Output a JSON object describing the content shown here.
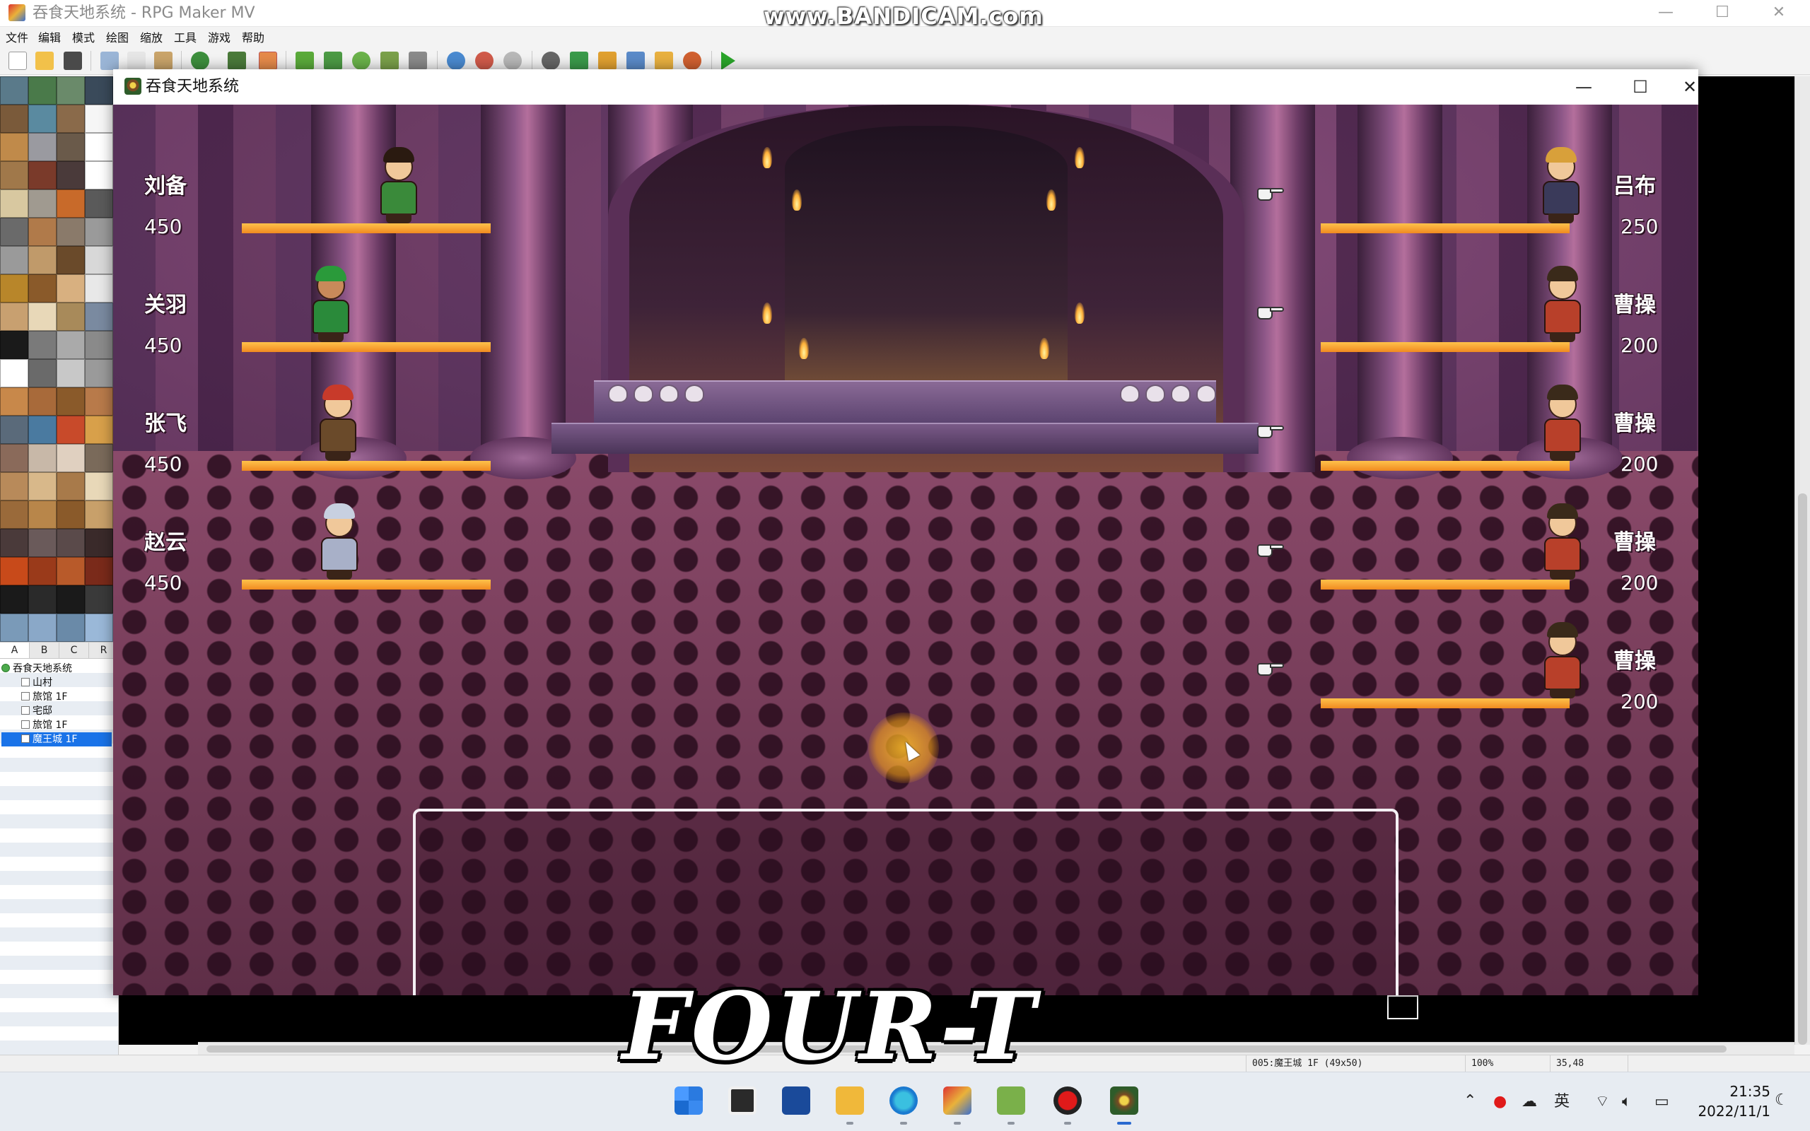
{
  "editor": {
    "title": "吞食天地系统 - RPG Maker MV",
    "watermark": "www.BANDICAM.com",
    "menus": [
      "文件",
      "编辑",
      "模式",
      "绘图",
      "缩放",
      "工具",
      "游戏",
      "帮助"
    ],
    "tileset_tabs": [
      "A",
      "B",
      "C",
      "R"
    ],
    "map_tree": [
      {
        "label": "吞食天地系统",
        "level": 0,
        "selected": false
      },
      {
        "label": "山村",
        "level": 1,
        "selected": false
      },
      {
        "label": "旅馆 1F",
        "level": 1,
        "selected": false
      },
      {
        "label": "宅邸",
        "level": 1,
        "selected": false
      },
      {
        "label": "旅馆 1F",
        "level": 1,
        "selected": false
      },
      {
        "label": "魔王城 1F",
        "level": 1,
        "selected": true
      }
    ],
    "status": {
      "map_info": "005:魔王城 1F (49x50)",
      "zoom": "100%",
      "coords": "35,48"
    }
  },
  "game_window": {
    "title": "吞食天地系统",
    "minimize": "—",
    "maximize": "☐",
    "close": "✕"
  },
  "allies": [
    {
      "name": "刘备",
      "hp": "450",
      "hp_fraction": 1.0
    },
    {
      "name": "关羽",
      "hp": "450",
      "hp_fraction": 1.0
    },
    {
      "name": "张飞",
      "hp": "450",
      "hp_fraction": 1.0
    },
    {
      "name": "赵云",
      "hp": "450",
      "hp_fraction": 1.0
    }
  ],
  "enemies": [
    {
      "name": "吕布",
      "hp": "250",
      "hp_fraction": 1.0
    },
    {
      "name": "曹操",
      "hp": "200",
      "hp_fraction": 1.0
    },
    {
      "name": "曹操",
      "hp": "200",
      "hp_fraction": 1.0
    },
    {
      "name": "曹操",
      "hp": "200",
      "hp_fraction": 1.0
    },
    {
      "name": "曹操",
      "hp": "200",
      "hp_fraction": 1.0
    }
  ],
  "overlay_logo": "FOUR-T",
  "taskbar": {
    "time": "21:35",
    "date": "2022/11/1",
    "ime": "英"
  },
  "colors": {
    "hp_bar": "#f5a030",
    "selection": "#1a73e8"
  }
}
